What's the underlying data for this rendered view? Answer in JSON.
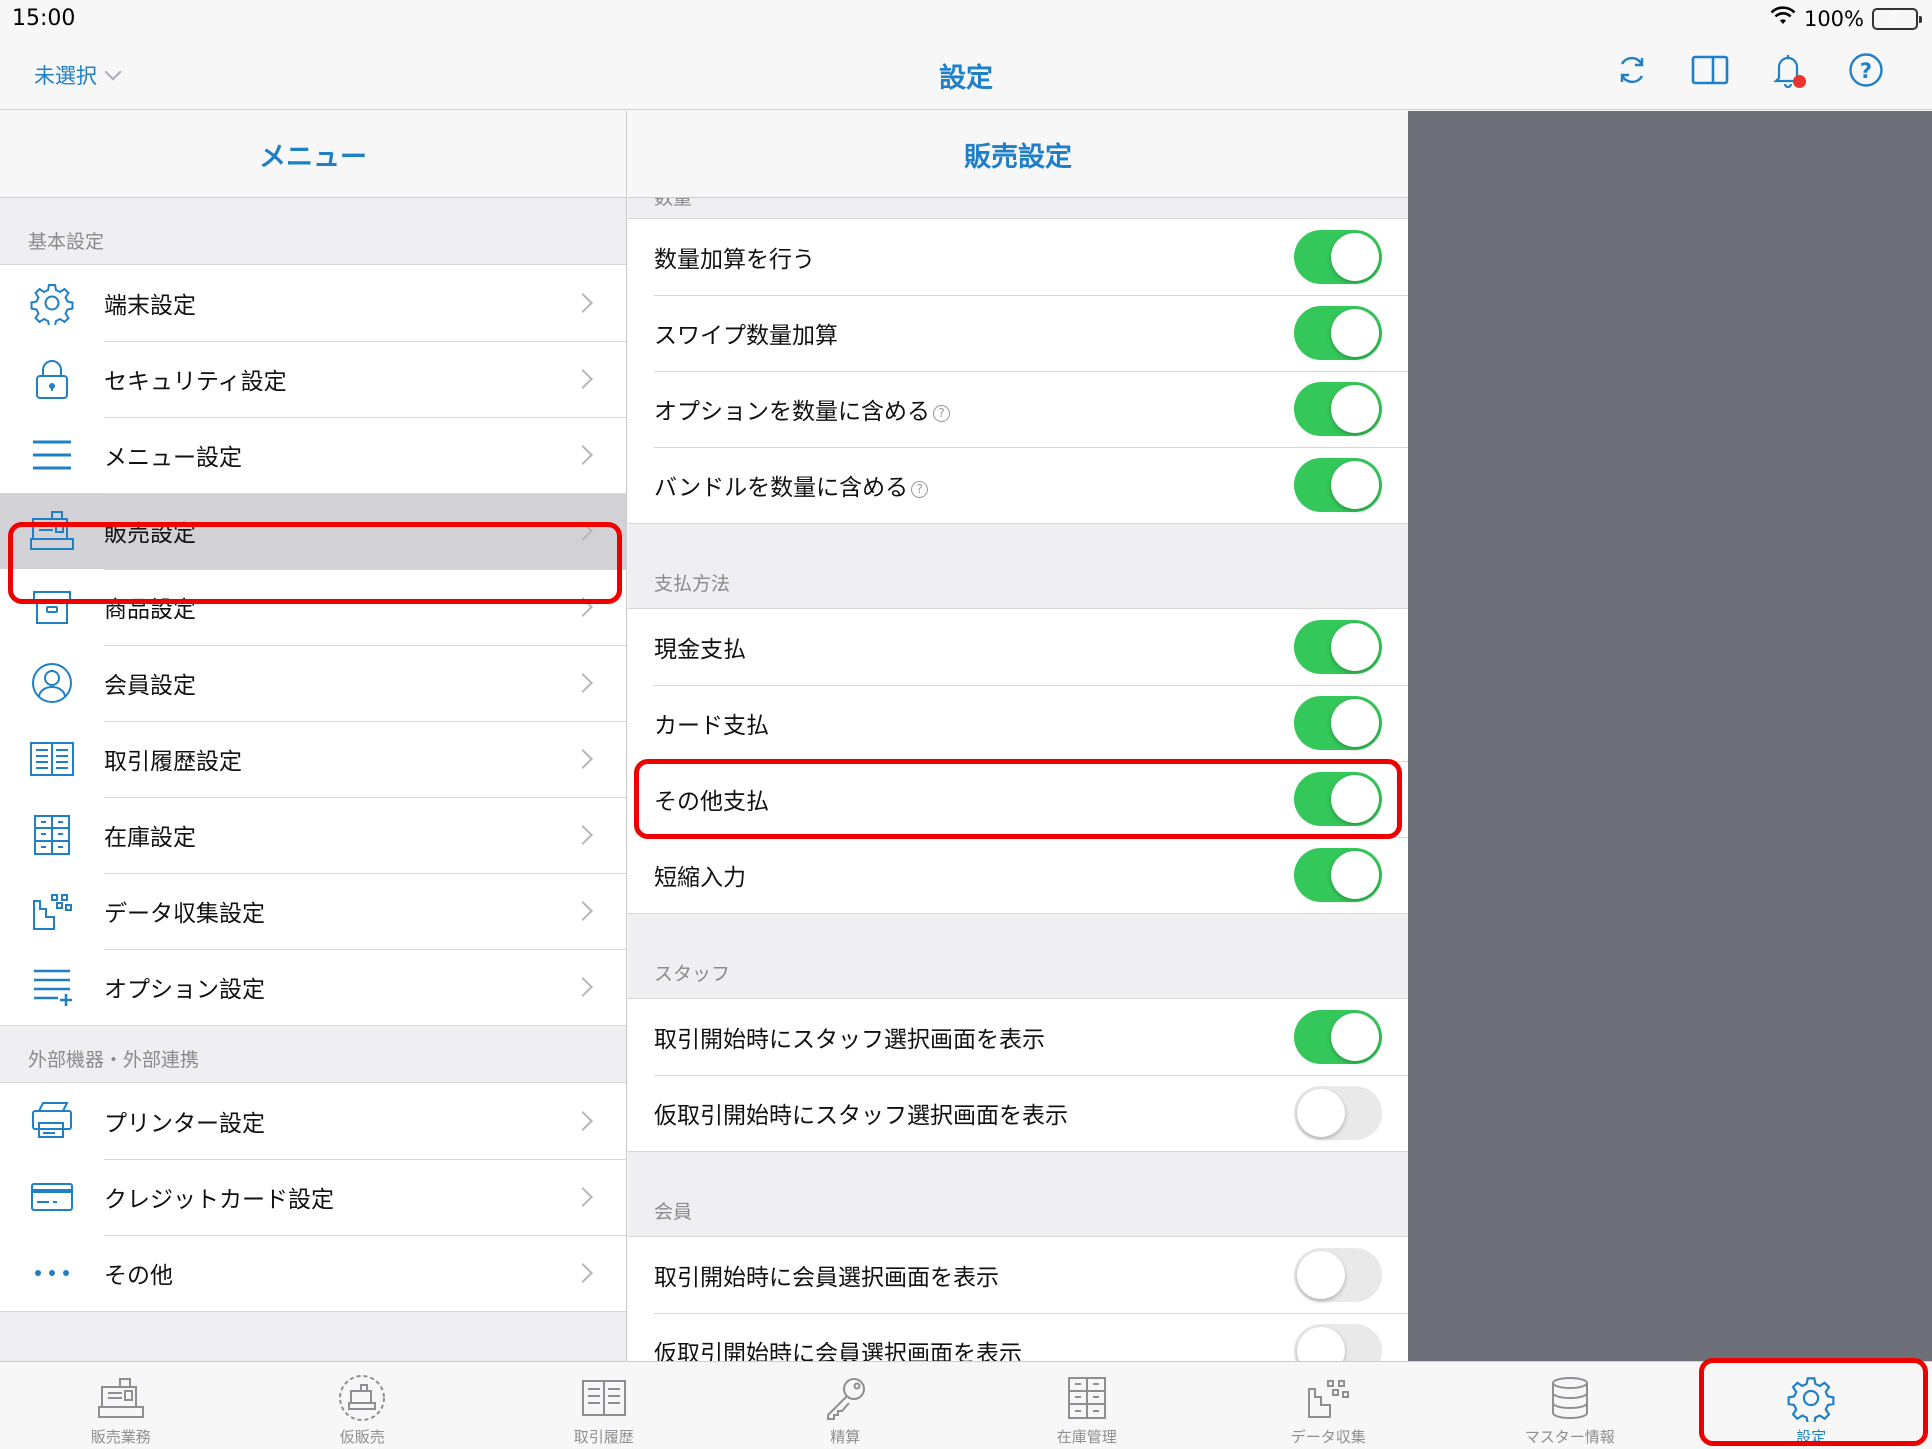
{
  "status_bar": {
    "time": "15:00",
    "battery": "100%"
  },
  "nav": {
    "store_selector": "未選択",
    "title": "設定"
  },
  "left_pane": {
    "title": "メニュー",
    "sections": [
      {
        "label": "基本設定",
        "items": [
          {
            "label": "端末設定",
            "icon": "gear-icon"
          },
          {
            "label": "セキュリティ設定",
            "icon": "lock-icon"
          },
          {
            "label": "メニュー設定",
            "icon": "menu-lines-icon"
          },
          {
            "label": "販売設定",
            "icon": "register-icon",
            "selected": true
          },
          {
            "label": "商品設定",
            "icon": "box-icon"
          },
          {
            "label": "会員設定",
            "icon": "person-icon"
          },
          {
            "label": "取引履歴設定",
            "icon": "book-icon"
          },
          {
            "label": "在庫設定",
            "icon": "shelf-icon"
          },
          {
            "label": "データ収集設定",
            "icon": "chart-dots-icon"
          },
          {
            "label": "オプション設定",
            "icon": "list-plus-icon"
          }
        ]
      },
      {
        "label": "外部機器・外部連携",
        "items": [
          {
            "label": "プリンター設定",
            "icon": "printer-icon"
          },
          {
            "label": "クレジットカード設定",
            "icon": "credit-card-icon"
          },
          {
            "label": "その他",
            "icon": "ellipsis-icon"
          }
        ]
      }
    ]
  },
  "mid_pane": {
    "title": "販売設定",
    "cut_label": "数量",
    "quantity_rows": [
      {
        "label": "数量加算を行う",
        "on": true,
        "help": false
      },
      {
        "label": "スワイプ数量加算",
        "on": true,
        "help": false
      },
      {
        "label": "オプションを数量に含める",
        "on": true,
        "help": true
      },
      {
        "label": "バンドルを数量に含める",
        "on": true,
        "help": true
      }
    ],
    "payment_label": "支払方法",
    "payment_rows": [
      {
        "label": "現金支払",
        "on": true
      },
      {
        "label": "カード支払",
        "on": true
      },
      {
        "label": "その他支払",
        "on": true
      },
      {
        "label": "短縮入力",
        "on": true
      }
    ],
    "staff_label": "スタッフ",
    "staff_rows": [
      {
        "label": "取引開始時にスタッフ選択画面を表示",
        "on": true
      },
      {
        "label": "仮取引開始時にスタッフ選択画面を表示",
        "on": false
      }
    ],
    "member_label": "会員",
    "member_rows": [
      {
        "label": "取引開始時に会員選択画面を表示",
        "on": false
      },
      {
        "label": "仮取引開始時に会員選択画面を表示",
        "on": false
      }
    ]
  },
  "tabs": [
    {
      "label": "販売業務",
      "icon": "register-icon"
    },
    {
      "label": "仮販売",
      "icon": "dashed-register-icon"
    },
    {
      "label": "取引履歴",
      "icon": "book-icon"
    },
    {
      "label": "精算",
      "icon": "key-icon"
    },
    {
      "label": "在庫管理",
      "icon": "shelf-icon"
    },
    {
      "label": "データ収集",
      "icon": "chart-dots-icon"
    },
    {
      "label": "マスター情報",
      "icon": "database-icon"
    },
    {
      "label": "設定",
      "icon": "gear-icon",
      "active": true
    }
  ],
  "colors": {
    "accent": "#1f7fc7",
    "toggle_on": "#34c759",
    "highlight": "#e00000",
    "detail_bg": "#6d7079"
  }
}
